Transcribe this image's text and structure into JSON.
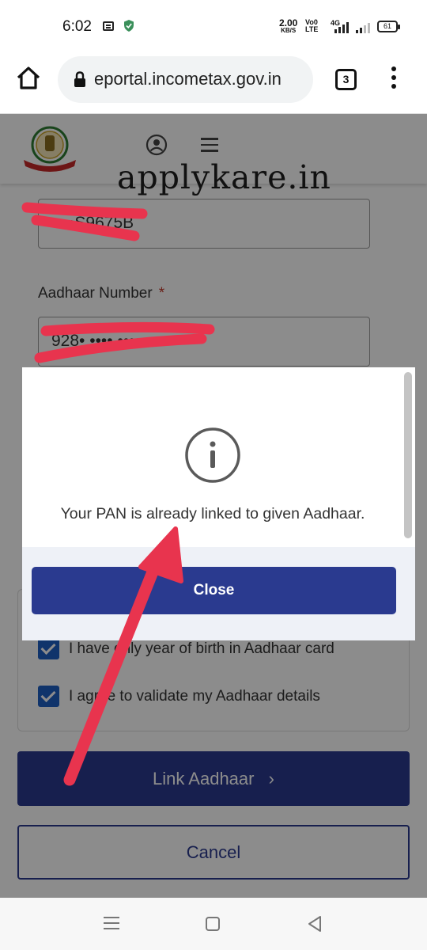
{
  "status_bar": {
    "time": "6:02",
    "net_speed_value": "2.00",
    "net_speed_unit": "KB/S",
    "volte_line1": "Vo0",
    "volte_line2": "LTE",
    "network": "4G",
    "battery": "61"
  },
  "browser": {
    "url": "eportal.incometax.gov.in",
    "tab_count": "3"
  },
  "form": {
    "pan_value": "••••S9675B",
    "aadhaar_label": "Aadhaar Number",
    "required_mark": "*",
    "aadhaar_value": "928• •••• ••••",
    "checkbox_year_of_birth": "I have only year of birth in Aadhaar card",
    "checkbox_agree": "I agree to validate my Aadhaar details",
    "link_button": "Link Aadhaar",
    "link_button_chevron": "›",
    "cancel_button": "Cancel"
  },
  "modal": {
    "message": "Your PAN is already linked to given Aadhaar.",
    "close_button": "Close"
  },
  "watermark": "applykare.in",
  "colors": {
    "primary_blue": "#2a3a8f",
    "checkbox_blue": "#1e5fc4",
    "annotation_red": "#e8344e"
  }
}
